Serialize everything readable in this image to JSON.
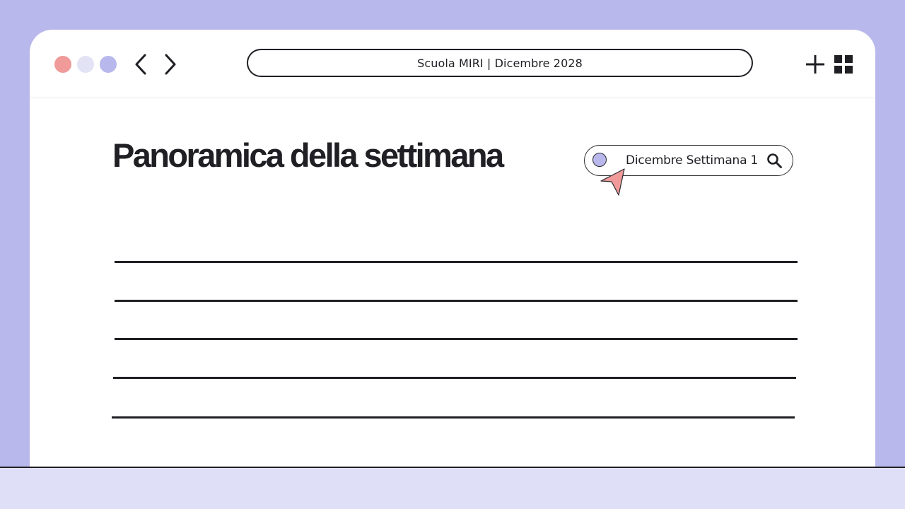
{
  "browser": {
    "address": "Scuola MIRI | Dicembre 2028",
    "window_dots": [
      "close-dot",
      "minimize-dot",
      "maximize-dot"
    ],
    "icons": {
      "back": "chevron-left-icon",
      "forward": "chevron-right-icon",
      "new_tab": "plus-icon",
      "apps": "grid-icon"
    }
  },
  "page": {
    "title": "Panoramica della settimana",
    "week_selector": {
      "label": "Dicembre Settimana 1",
      "icon": "search-icon"
    },
    "empty_lines": 5
  },
  "colors": {
    "background": "#b8b8ec",
    "window": "#ffffff",
    "accent_red": "#f09a9a",
    "accent_lavender": "#b8b8ec",
    "accent_light": "#e3e3f6",
    "ink": "#1f1f24",
    "bottom_band": "#e0dff8"
  }
}
